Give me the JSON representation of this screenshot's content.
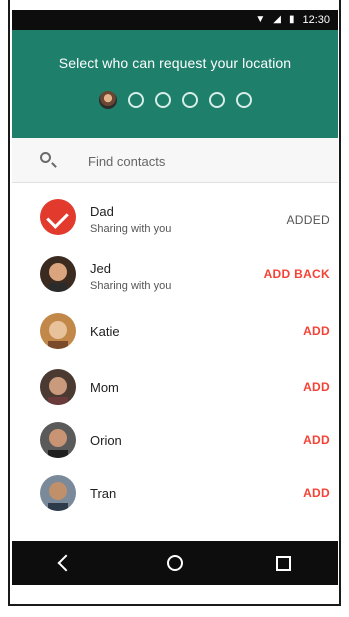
{
  "status_bar": {
    "time": "12:30"
  },
  "header": {
    "title": "Select who can request your location",
    "step_count": 6,
    "active_step": 1
  },
  "search": {
    "placeholder": "Find contacts"
  },
  "contacts": [
    {
      "name": "Dad",
      "subtitle": "Sharing with you",
      "action": "ADDED"
    },
    {
      "name": "Jed",
      "subtitle": "Sharing with you",
      "action": "ADD BACK"
    },
    {
      "name": "Katie",
      "subtitle": "",
      "action": "ADD"
    },
    {
      "name": "Mom",
      "subtitle": "",
      "action": "ADD"
    },
    {
      "name": "Orion",
      "subtitle": "",
      "action": "ADD"
    },
    {
      "name": "Tran",
      "subtitle": "",
      "action": "ADD"
    }
  ],
  "nav": {
    "back_icon": "triangle-back-icon",
    "home_icon": "circle-home-icon",
    "recents_icon": "square-recents-icon"
  },
  "colors": {
    "header": "#1e7f6b",
    "accent": "#f44336"
  }
}
